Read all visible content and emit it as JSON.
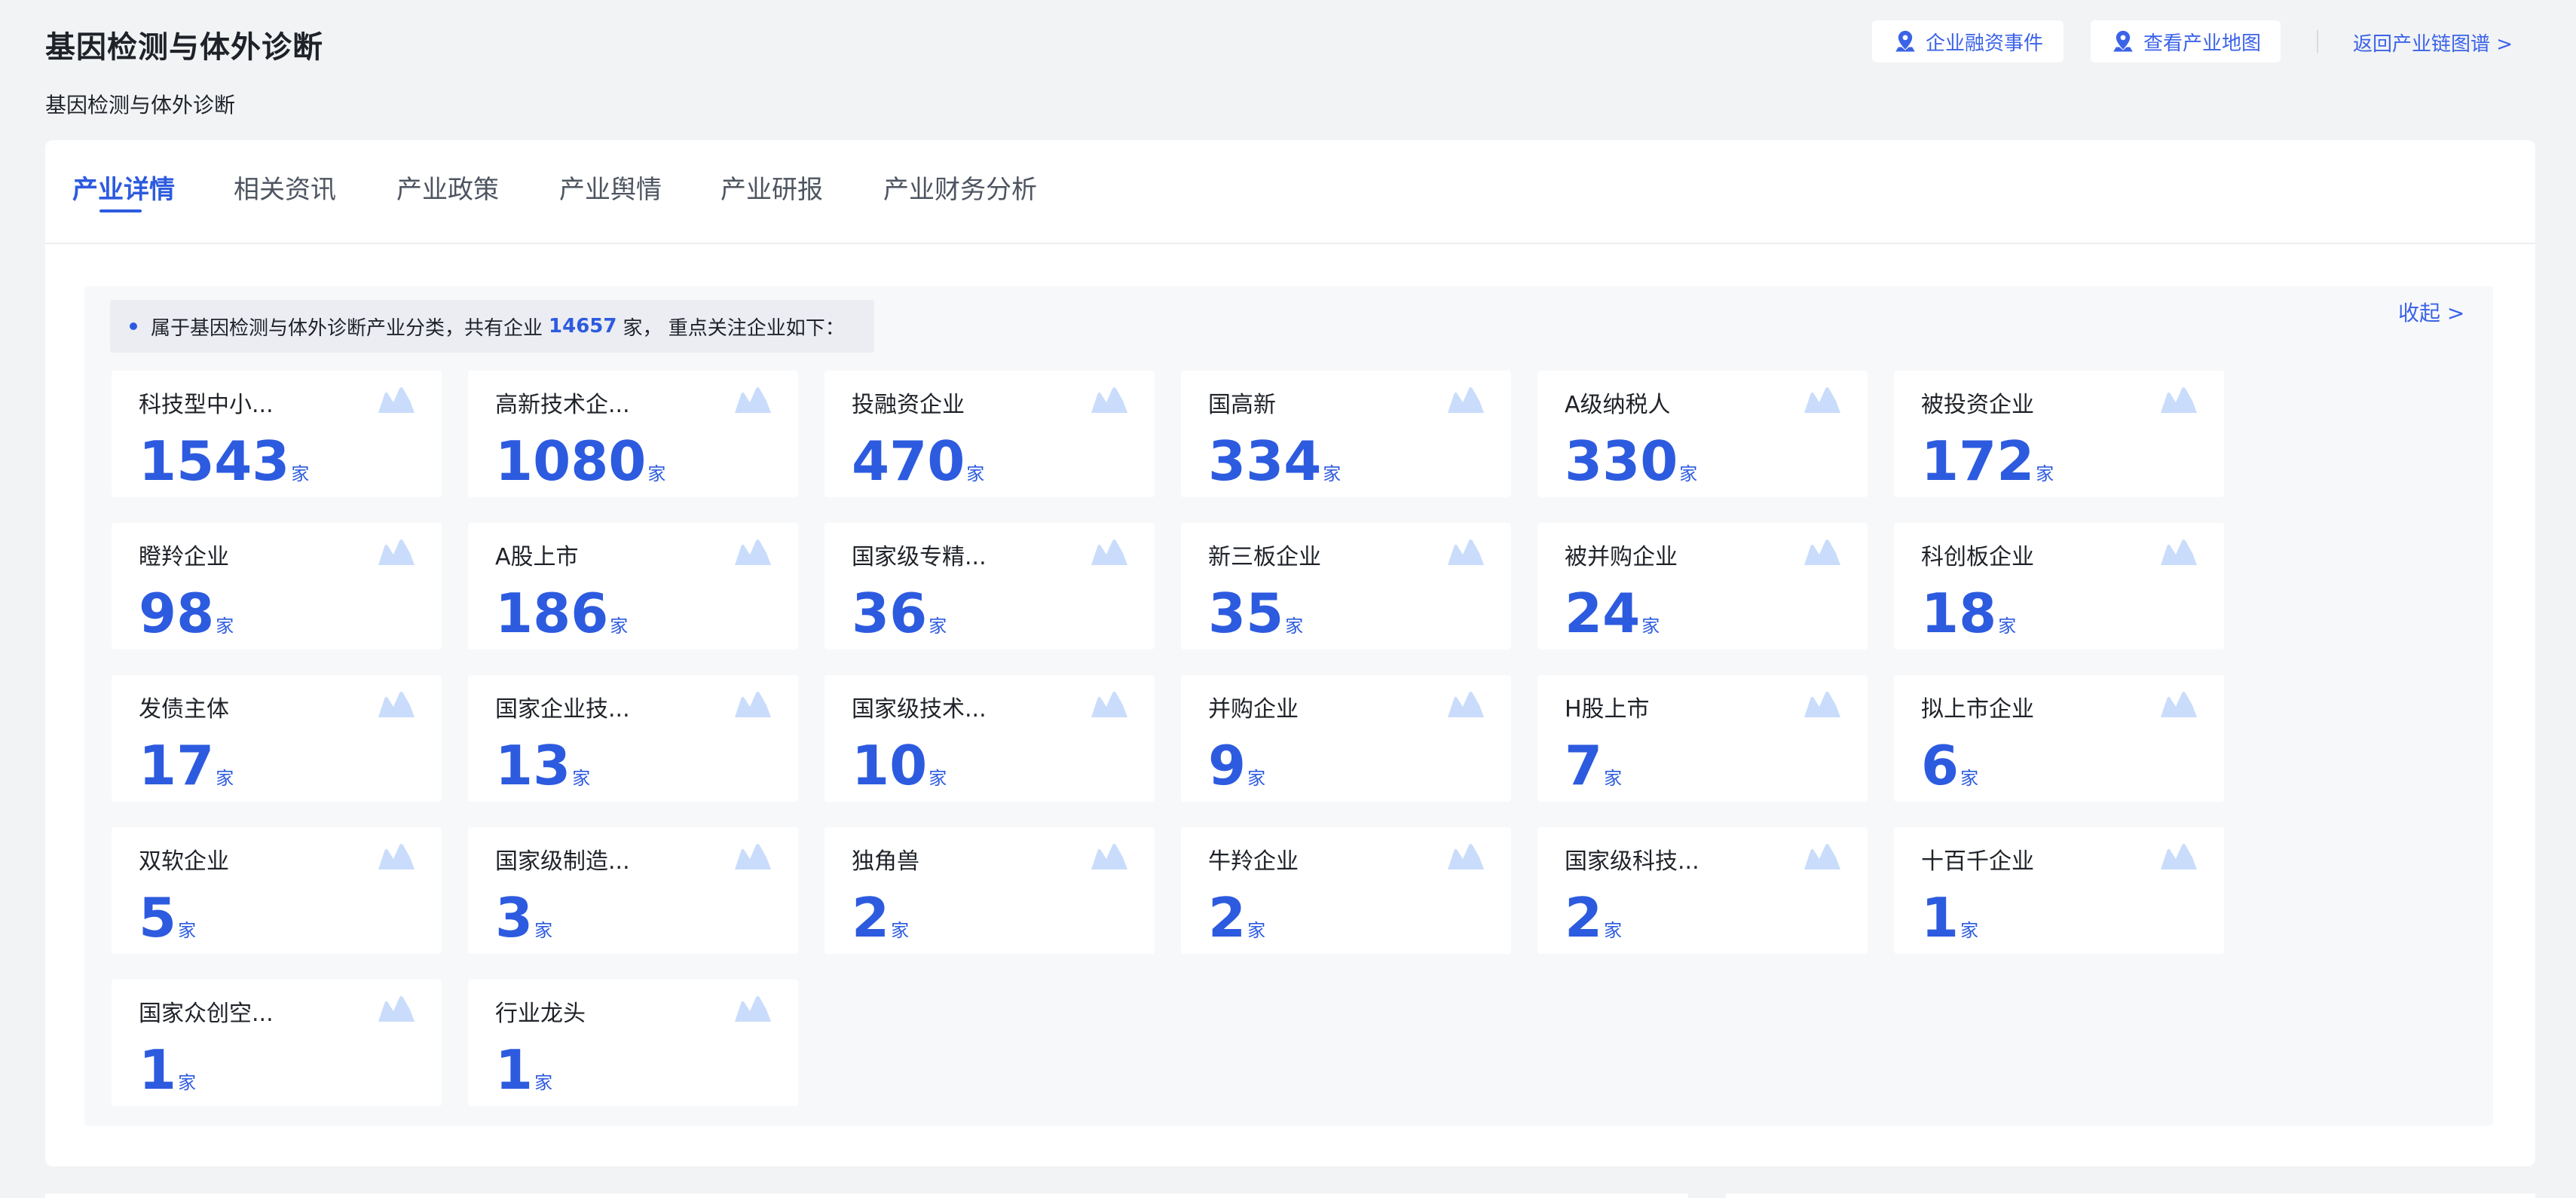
{
  "header": {
    "title": "基因检测与体外诊断",
    "subtitle": "基因检测与体外诊断",
    "buttons": [
      {
        "label": "企业融资事件",
        "icon": "location-pin-icon"
      },
      {
        "label": "查看产业地图",
        "icon": "location-pin-icon"
      }
    ],
    "back_link": "返回产业链图谱 >"
  },
  "tabs": [
    {
      "label": "产业详情",
      "active": true
    },
    {
      "label": "相关资讯",
      "active": false
    },
    {
      "label": "产业政策",
      "active": false
    },
    {
      "label": "产业舆情",
      "active": false
    },
    {
      "label": "产业研报",
      "active": false
    },
    {
      "label": "产业财务分析",
      "active": false
    }
  ],
  "summary": {
    "prefix": "属于基因检测与体外诊断产业分类，共有企业",
    "count": "14657",
    "suffix": "家， 重点关注企业如下："
  },
  "collapse_label": "收起 >",
  "unit": "家",
  "colors": {
    "accent": "#2d5bdf",
    "icon_fill": "#c9dcfb",
    "page_bg": "#f2f3f5"
  },
  "cards": [
    {
      "label": "科技型中小...",
      "value": "1543"
    },
    {
      "label": "高新技术企...",
      "value": "1080"
    },
    {
      "label": "投融资企业",
      "value": "470"
    },
    {
      "label": "国高新",
      "value": "334"
    },
    {
      "label": "A级纳税人",
      "value": "330"
    },
    {
      "label": "被投资企业",
      "value": "172"
    },
    {
      "label": "瞪羚企业",
      "value": "98"
    },
    {
      "label": "A股上市",
      "value": "186"
    },
    {
      "label": "国家级专精...",
      "value": "36"
    },
    {
      "label": "新三板企业",
      "value": "35"
    },
    {
      "label": "被并购企业",
      "value": "24"
    },
    {
      "label": "科创板企业",
      "value": "18"
    },
    {
      "label": "发债主体",
      "value": "17"
    },
    {
      "label": "国家企业技...",
      "value": "13"
    },
    {
      "label": "国家级技术...",
      "value": "10"
    },
    {
      "label": "并购企业",
      "value": "9"
    },
    {
      "label": "H股上市",
      "value": "7"
    },
    {
      "label": "拟上市企业",
      "value": "6"
    },
    {
      "label": "双软企业",
      "value": "5"
    },
    {
      "label": "国家级制造...",
      "value": "3"
    },
    {
      "label": "独角兽",
      "value": "2"
    },
    {
      "label": "牛羚企业",
      "value": "2"
    },
    {
      "label": "国家级科技...",
      "value": "2"
    },
    {
      "label": "十百千企业",
      "value": "1"
    },
    {
      "label": "国家众创空...",
      "value": "1"
    },
    {
      "label": "行业龙头",
      "value": "1"
    }
  ]
}
